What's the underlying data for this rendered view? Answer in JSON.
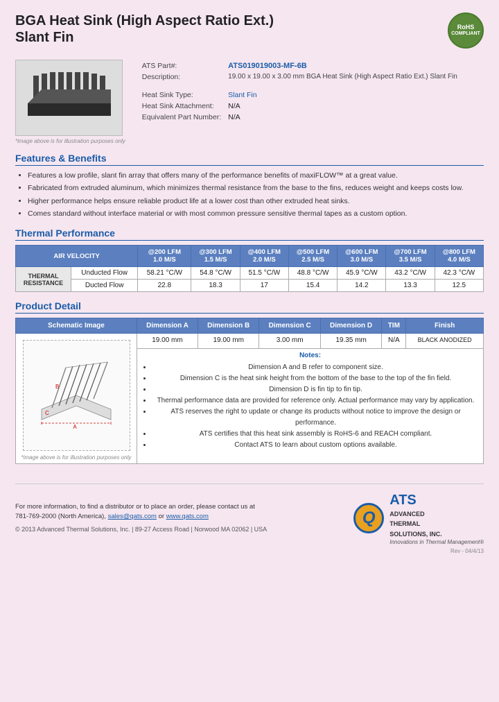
{
  "page": {
    "title_line1": "BGA Heat Sink (High Aspect Ratio Ext.)",
    "title_line2": "Slant Fin",
    "rohs": {
      "line1": "RoHS",
      "line2": "COMPLIANT"
    },
    "image_caption": "*image above is for illustration purposes only"
  },
  "product": {
    "ats_part_label": "ATS Part#:",
    "ats_part_value": "ATS019019003-MF-6B",
    "description_label": "Description:",
    "description_value": "19.00 x 19.00 x 3.00 mm  BGA Heat Sink (High Aspect Ratio Ext.) Slant Fin",
    "heat_sink_type_label": "Heat Sink Type:",
    "heat_sink_type_value": "Slant Fin",
    "attachment_label": "Heat Sink Attachment:",
    "attachment_value": "N/A",
    "equiv_part_label": "Equivalent Part Number:",
    "equiv_part_value": "N/A"
  },
  "features": {
    "heading": "Features & Benefits",
    "items": [
      "Features a low profile, slant fin array that offers many of the performance benefits of maxiFLOW™ at a great value.",
      "Fabricated from extruded aluminum, which minimizes thermal resistance from the base to the fins, reduces weight and keeps costs low.",
      "Higher performance helps ensure reliable product life at a lower cost than other extruded heat sinks.",
      "Comes standard without interface material or with most common pressure sensitive thermal tapes as a custom option."
    ]
  },
  "thermal": {
    "heading": "Thermal Performance",
    "col_headers": [
      {
        "line1": "AIR VELOCITY",
        "line2": ""
      },
      {
        "line1": "@200 LFM",
        "line2": "1.0 M/S"
      },
      {
        "line1": "@300 LFM",
        "line2": "1.5 M/S"
      },
      {
        "line1": "@400 LFM",
        "line2": "2.0 M/S"
      },
      {
        "line1": "@500 LFM",
        "line2": "2.5 M/S"
      },
      {
        "line1": "@600 LFM",
        "line2": "3.0 M/S"
      },
      {
        "line1": "@700 LFM",
        "line2": "3.5 M/S"
      },
      {
        "line1": "@800 LFM",
        "line2": "4.0 M/S"
      }
    ],
    "row_label": "THERMAL RESISTANCE",
    "rows": [
      {
        "label": "Unducted Flow",
        "values": [
          "58.21 °C/W",
          "54.8 °C/W",
          "51.5 °C/W",
          "48.8 °C/W",
          "45.9 °C/W",
          "43.2 °C/W",
          "42.3 °C/W"
        ]
      },
      {
        "label": "Ducted Flow",
        "values": [
          "22.8",
          "18.3",
          "17",
          "15.4",
          "14.2",
          "13.3",
          "12.5"
        ]
      }
    ]
  },
  "product_detail": {
    "heading": "Product Detail",
    "col_headers": [
      "Schematic Image",
      "Dimension A",
      "Dimension B",
      "Dimension C",
      "Dimension D",
      "TIM",
      "Finish"
    ],
    "dim_values": [
      "19.00 mm",
      "19.00 mm",
      "3.00 mm",
      "19.35 mm",
      "N/A",
      "BLACK ANODIZED"
    ],
    "notes_label": "Notes:",
    "notes": [
      "Dimension A and B refer to component size.",
      "Dimension C is the heat sink height from the bottom of the base to the top of the fin field.",
      "Dimension D is fin tip to fin tip.",
      "Thermal performance data are provided for reference only. Actual performance may vary by application.",
      "ATS reserves the right to update or change its products without notice to improve the design or performance.",
      "ATS certifies that this heat sink assembly is RoHS-6 and REACH compliant.",
      "Contact ATS to learn about custom options available."
    ],
    "image_caption": "*image above is for illustration purposes only"
  },
  "footer": {
    "contact_text": "For more information, to find a distributor or to place an order, please contact us at",
    "phone": "781-769-2000 (North America),",
    "email": "sales@qats.com",
    "email_connector": " or ",
    "website": "www.qats.com",
    "copyright": "© 2013 Advanced Thermal Solutions, Inc.  |  89-27 Access Road  |  Norwood MA  02062  |  USA",
    "ats_logo_q": "Q",
    "ats_logo_name": "ATS",
    "ats_logo_full": "ADVANCED\nTHERMAL\nSOLUTIONS, INC.",
    "ats_tagline": "Innovations in Thermal Management®",
    "rev": "Rev - 04/4/13"
  }
}
